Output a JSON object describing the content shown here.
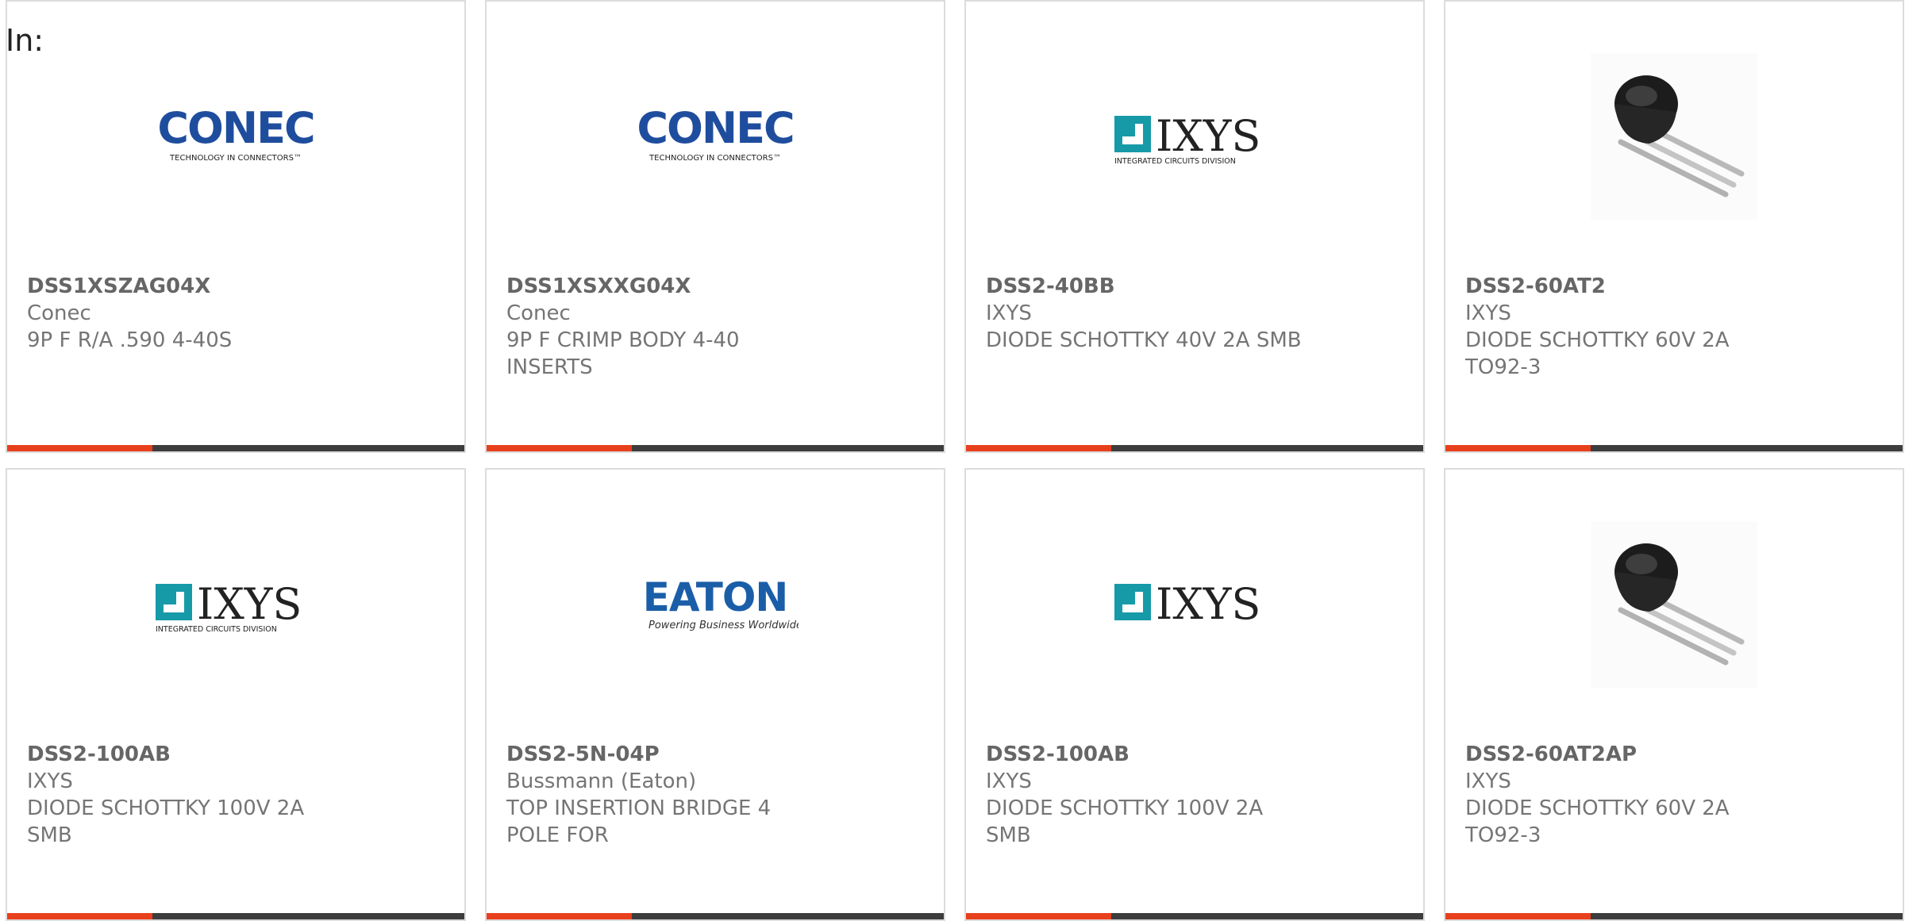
{
  "filter_label": "In:",
  "colors": {
    "accent": "#e8401c",
    "bar": "#3d3d3d",
    "conec_blue": "#1f4d9e",
    "ixys_teal": "#179aa8",
    "eaton_blue": "#1b5ea8"
  },
  "products": [
    {
      "part": "DSS1XSZAG04X",
      "manufacturer": "Conec",
      "description": "9P F R/A .590 4-40S",
      "image": "conec-logo",
      "logo_text": "CONEC",
      "logo_sub": "TECHNOLOGY IN CONNECTORS™"
    },
    {
      "part": "DSS1XSXXG04X",
      "manufacturer": "Conec",
      "description": "9P F CRIMP BODY 4-40 INSERTS",
      "image": "conec-logo",
      "logo_text": "CONEC",
      "logo_sub": "TECHNOLOGY IN CONNECTORS™"
    },
    {
      "part": "DSS2-40BB",
      "manufacturer": "IXYS",
      "description": "DIODE SCHOTTKY 40V 2A SMB",
      "image": "ixys-logo",
      "logo_text": "IXYS",
      "logo_sub": "INTEGRATED CIRCUITS DIVISION"
    },
    {
      "part": "DSS2-60AT2",
      "manufacturer": "IXYS",
      "description": "DIODE SCHOTTKY 60V 2A TO92-3",
      "image": "to92-transistor"
    },
    {
      "part": "DSS2-100AB",
      "manufacturer": "IXYS",
      "description": "DIODE SCHOTTKY 100V 2A SMB",
      "image": "ixys-logo",
      "logo_text": "IXYS",
      "logo_sub": "INTEGRATED CIRCUITS DIVISION"
    },
    {
      "part": "DSS2-5N-04P",
      "manufacturer": "Bussmann (Eaton)",
      "description": "TOP INSERTION BRIDGE 4 POLE FOR",
      "image": "eaton-logo",
      "logo_text": "EATON",
      "logo_sub": "Powering Business Worldwide"
    },
    {
      "part": "DSS2-100AB",
      "manufacturer": "IXYS",
      "description": "DIODE SCHOTTKY 100V 2A SMB",
      "image": "ixys-logo",
      "logo_text": "IXYS"
    },
    {
      "part": "DSS2-60AT2AP",
      "manufacturer": "IXYS",
      "description": "DIODE SCHOTTKY 60V 2A TO92-3",
      "image": "to92-transistor"
    }
  ]
}
